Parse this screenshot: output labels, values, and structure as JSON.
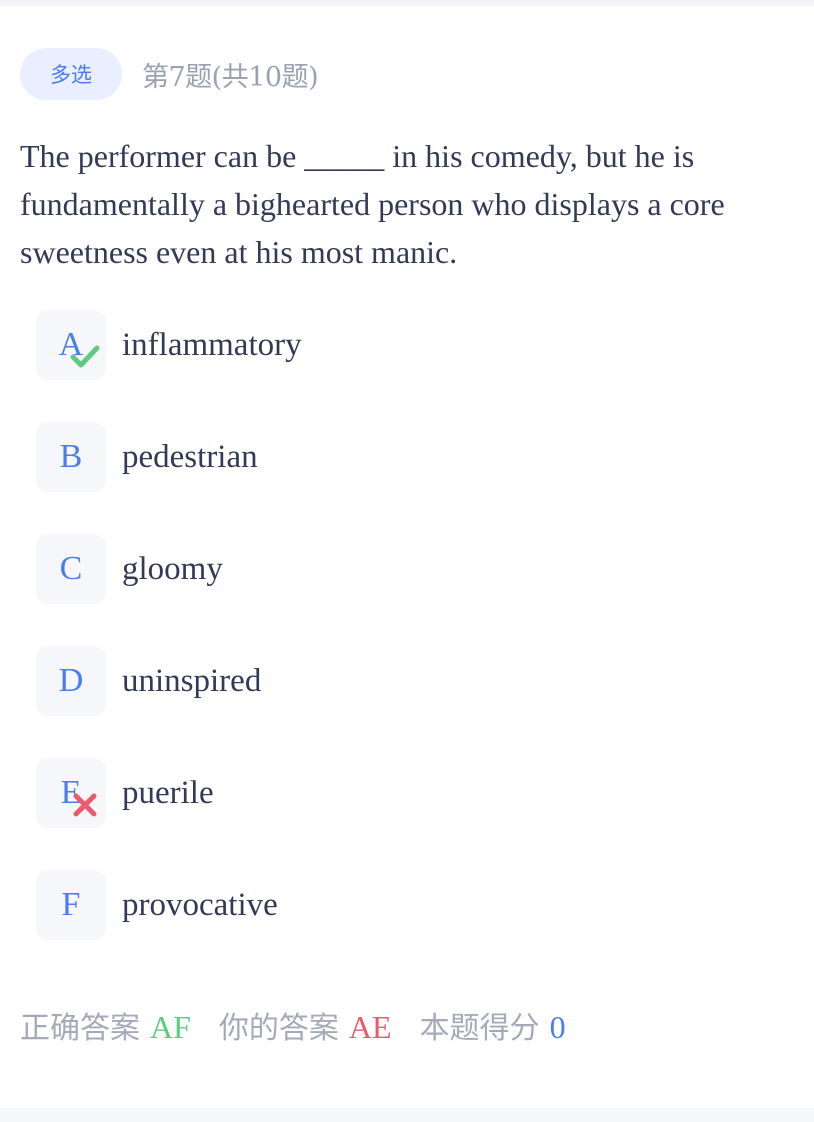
{
  "header": {
    "type_label": "多选",
    "progress": "第7题(共10题)"
  },
  "question": {
    "text": "The performer can be _____ in his comedy, but he is fundamentally a bighearted person who displays a core sweetness even at his most manic."
  },
  "options": [
    {
      "letter": "A",
      "text": "inflammatory",
      "mark": "check-icon"
    },
    {
      "letter": "B",
      "text": "pedestrian",
      "mark": ""
    },
    {
      "letter": "C",
      "text": "gloomy",
      "mark": ""
    },
    {
      "letter": "D",
      "text": "uninspired",
      "mark": ""
    },
    {
      "letter": "E",
      "text": "puerile",
      "mark": "cross-icon"
    },
    {
      "letter": "F",
      "text": "provocative",
      "mark": ""
    }
  ],
  "footer": {
    "correct_label": "正确答案",
    "correct_value": "AF",
    "your_label": "你的答案",
    "your_value": "AE",
    "score_label": "本题得分",
    "score_value": "0"
  },
  "colors": {
    "accent": "#4b7cf0",
    "correct": "#5ccc7e",
    "wrong": "#ec5a6c",
    "muted": "#a4aab8"
  }
}
